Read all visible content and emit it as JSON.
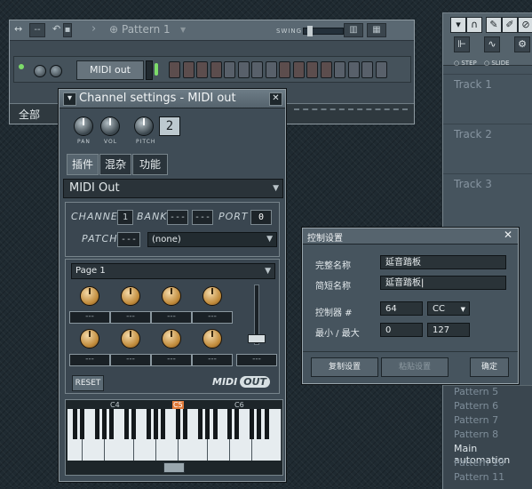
{
  "rack": {
    "pattern_label": "Pattern 1",
    "swing_label": "SWING",
    "channel_name": "MIDI out",
    "footer_label": "全部",
    "steps": 16
  },
  "playlist": {
    "radio_step": "STEP",
    "radio_slide": "SLIDE",
    "tracks": [
      "Track 1",
      "Track 2",
      "Track 3"
    ],
    "patterns": [
      "Pattern 5",
      "Pattern 6",
      "Pattern 7",
      "Pattern 8",
      "Main automation",
      "Pattern 10",
      "Pattern 11"
    ]
  },
  "channel_settings": {
    "title": "Channel settings - MIDI out",
    "pan_label": "PAN",
    "vol_label": "VOL",
    "pitch_label": "PITCH",
    "pitch_value": "2",
    "tabs": [
      "插件",
      "混杂",
      "功能"
    ],
    "plugin_name": "MIDI Out",
    "channel_label": "CHANNEL",
    "channel_value": "1",
    "bank_label": "BANK",
    "bank_value1": "---",
    "bank_value2": "---",
    "port_label": "PORT",
    "port_value": "0",
    "patch_label": "PATCH",
    "patch_value": "---",
    "patch_select": "(none)",
    "page_label": "Page 1",
    "knob_slot_text": "---",
    "reset_label": "RESET",
    "logo_text": "MIDI",
    "logo_badge": "OUT",
    "octaves": [
      "C4",
      "C5",
      "C6"
    ]
  },
  "dialog": {
    "title": "控制设置",
    "full_name_label": "完整名称",
    "full_name_value": "延音踏板",
    "short_name_label": "简短名称",
    "short_name_value": "延音踏板",
    "controller_label": "控制器 #",
    "controller_value": "64",
    "controller_type": "CC",
    "range_label": "最小 / 最大",
    "min_value": "0",
    "max_value": "127",
    "copy_label": "复制设置",
    "paste_label": "粘贴设置",
    "ok_label": "确定"
  }
}
